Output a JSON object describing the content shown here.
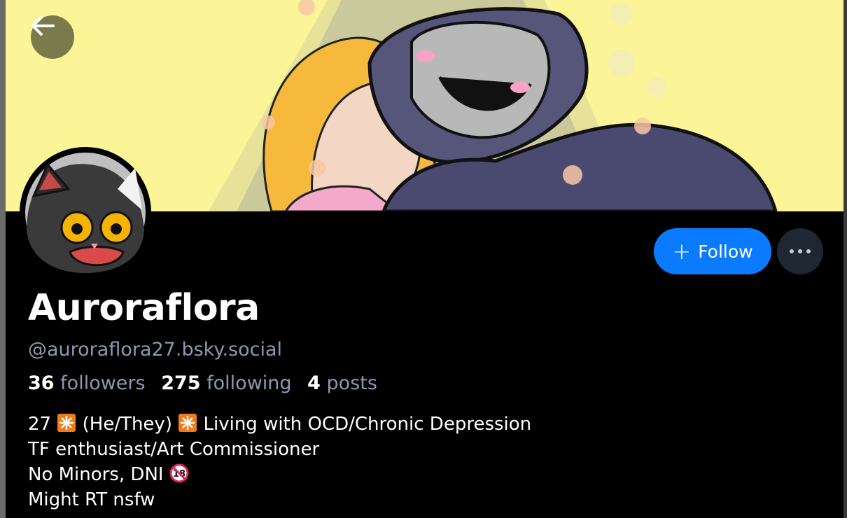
{
  "profile": {
    "display_name": "Auroraflora",
    "handle": "@auroraflora27.bsky.social",
    "stats": {
      "followers_count": "36",
      "followers_label": "followers",
      "following_count": "275",
      "following_label": "following",
      "posts_count": "4",
      "posts_label": "posts"
    },
    "bio": {
      "line1_a": "27",
      "line1_b": "(He/They)",
      "line1_c": "Living with OCD/Chronic Depression",
      "line2": "TF enthusiast/Art Commissioner",
      "line3": "No Minors, DNI",
      "line4": "Might RT nsfw"
    }
  },
  "actions": {
    "follow_label": "Follow",
    "more_icon": "ellipsis-icon",
    "back_icon": "arrow-left-icon"
  },
  "colors": {
    "accent": "#0a7bff",
    "background": "#000000",
    "muted_text": "#8a9aae",
    "banner_bg": "#fbf597"
  }
}
